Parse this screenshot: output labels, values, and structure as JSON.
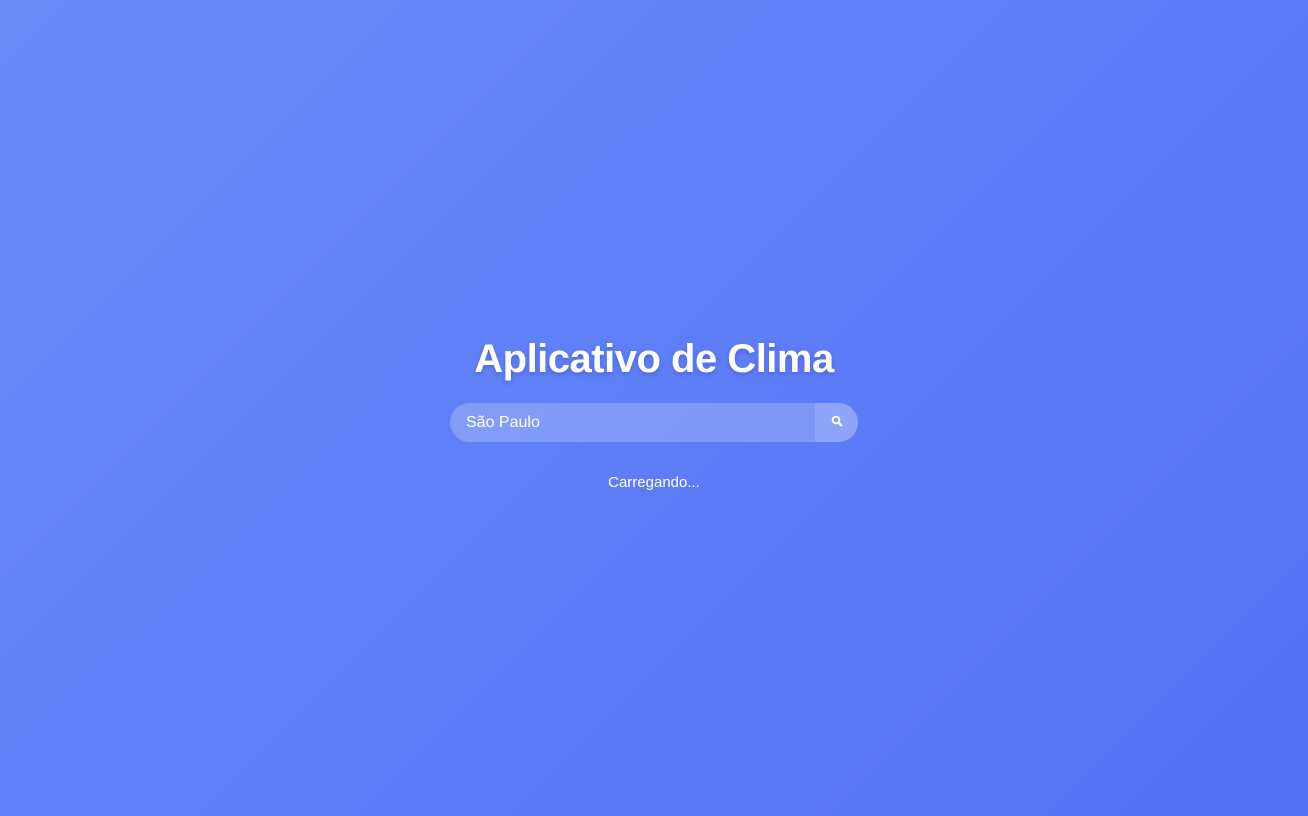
{
  "app": {
    "title": "Aplicativo de Clima"
  },
  "search": {
    "value": "São Paulo",
    "placeholder": "São Paulo",
    "button_icon": "search-icon"
  },
  "status": {
    "text": "Carregando..."
  },
  "colors": {
    "background_start": "#6a8cf9",
    "background_end": "#5270f6",
    "text": "#ffffff"
  }
}
